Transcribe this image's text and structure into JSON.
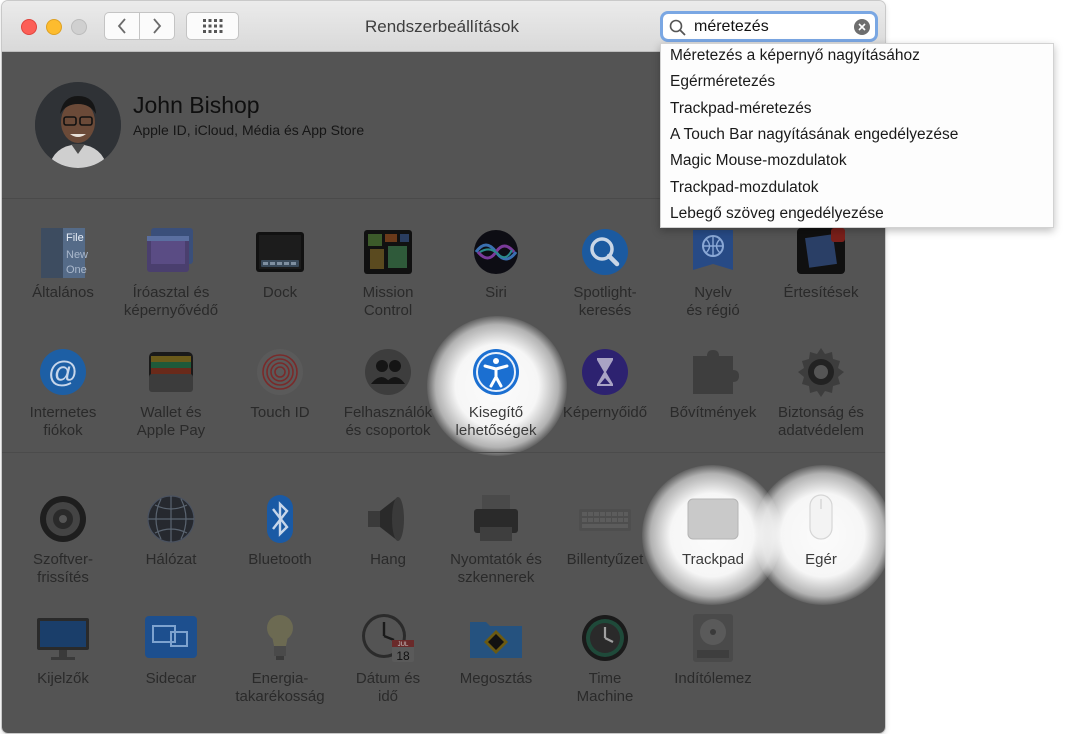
{
  "window": {
    "title": "Rendszerbeállítások"
  },
  "search": {
    "value": "méretezés"
  },
  "suggestions": [
    "Méretezés a képernyő nagyításához",
    "Egérméretezés",
    "Trackpad-méretezés",
    "A Touch Bar nagyításának engedélyezése",
    "Magic Mouse-mozdulatok",
    "Trackpad-mozdulatok",
    "Lebegő szöveg engedélyezése"
  ],
  "profile": {
    "name": "John Bishop",
    "subtitle": "Apple ID, iCloud, Média és App Store"
  },
  "prefs": {
    "general": "Általános",
    "desktop": "Íróasztal és\nképernyővédő",
    "dock": "Dock",
    "mission": "Mission\nControl",
    "siri": "Siri",
    "spotlight": "Spotlight-\nkeresés",
    "language": "Nyelv\nés régió",
    "notifications": "Értesítések",
    "internet": "Internetes\nfiókok",
    "wallet": "Wallet és\nApple Pay",
    "touchid": "Touch ID",
    "users": "Felhasználók\nés csoportok",
    "accessibility": "Kisegítő\nlehetőségek",
    "screentime": "Képernyőidő",
    "extensions": "Bővítmények",
    "security": "Biztonság és\nadatvédelem",
    "software": "Szoftver-\nfrissítés",
    "network": "Hálózat",
    "bluetooth": "Bluetooth",
    "sound": "Hang",
    "printers": "Nyomtatók és\nszkennerek",
    "keyboard": "Billentyűzet",
    "trackpad": "Trackpad",
    "mouse": "Egér",
    "displays": "Kijelzők",
    "sidecar": "Sidecar",
    "energy": "Energia-\ntakarékosság",
    "datetime": "Dátum és\nidő",
    "sharing": "Megosztás",
    "timemachine": "Time\nMachine",
    "startup": "Indítólemez"
  },
  "icon_texts": {
    "general_file": "File",
    "general_new": "New",
    "general_one": "One",
    "calendar_day": "18",
    "calendar_month": "JUL"
  },
  "colors": {
    "accent": "#7aa7e3",
    "dim_overlay": "#545454"
  }
}
